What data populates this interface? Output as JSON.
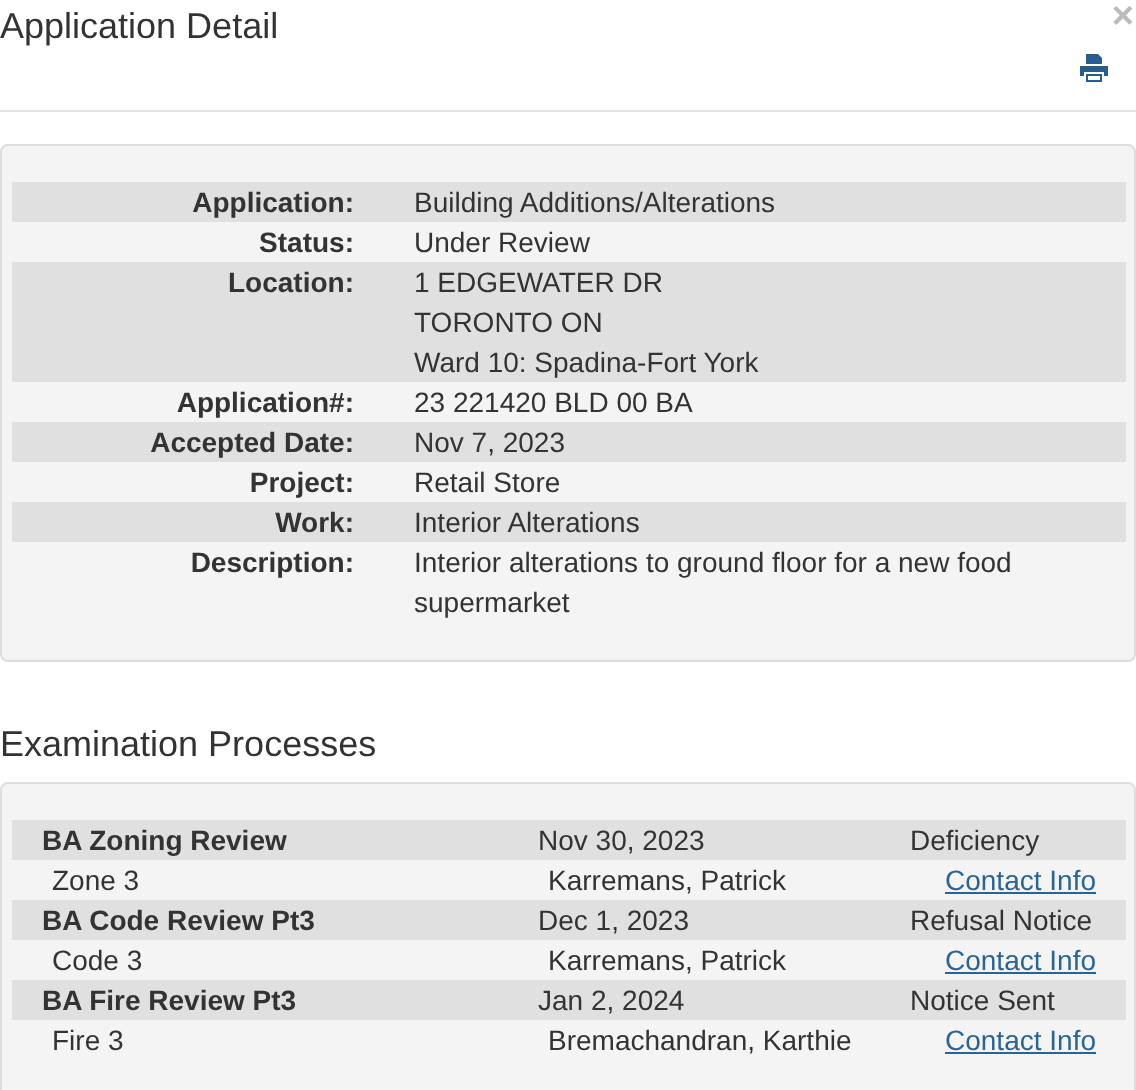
{
  "dialog": {
    "title": "Application Detail",
    "close": "×"
  },
  "details": [
    {
      "label": "Application:",
      "lines": [
        "Building Additions/Alterations"
      ]
    },
    {
      "label": "Status:",
      "lines": [
        "Under Review"
      ]
    },
    {
      "label": "Location:",
      "lines": [
        "1 EDGEWATER DR",
        "TORONTO ON",
        "Ward 10: Spadina-Fort York"
      ]
    },
    {
      "label": "Application#:",
      "lines": [
        "23 221420 BLD 00 BA"
      ]
    },
    {
      "label": "Accepted Date:",
      "lines": [
        "Nov 7, 2023"
      ]
    },
    {
      "label": "Project:",
      "lines": [
        "Retail Store"
      ]
    },
    {
      "label": "Work:",
      "lines": [
        "Interior Alterations"
      ]
    },
    {
      "label": "Description:",
      "lines": [
        "Interior alterations to ground floor for a new food supermarket"
      ]
    }
  ],
  "examination": {
    "title": "Examination Processes",
    "processes": [
      {
        "name": "BA Zoning Review",
        "date": "Nov 30, 2023",
        "status": "Deficiency",
        "code": "Zone 3",
        "examiner": "Karremans, Patrick",
        "link": "Contact Info"
      },
      {
        "name": "BA Code Review Pt3",
        "date": "Dec 1, 2023",
        "status": "Refusal Notice",
        "code": "Code 3",
        "examiner": "Karremans, Patrick",
        "link": "Contact Info"
      },
      {
        "name": "BA Fire Review Pt3",
        "date": "Jan 2, 2024",
        "status": "Notice Sent",
        "code": "Fire 3",
        "examiner": "Bremachandran, Karthie",
        "link": "Contact Info"
      }
    ]
  }
}
